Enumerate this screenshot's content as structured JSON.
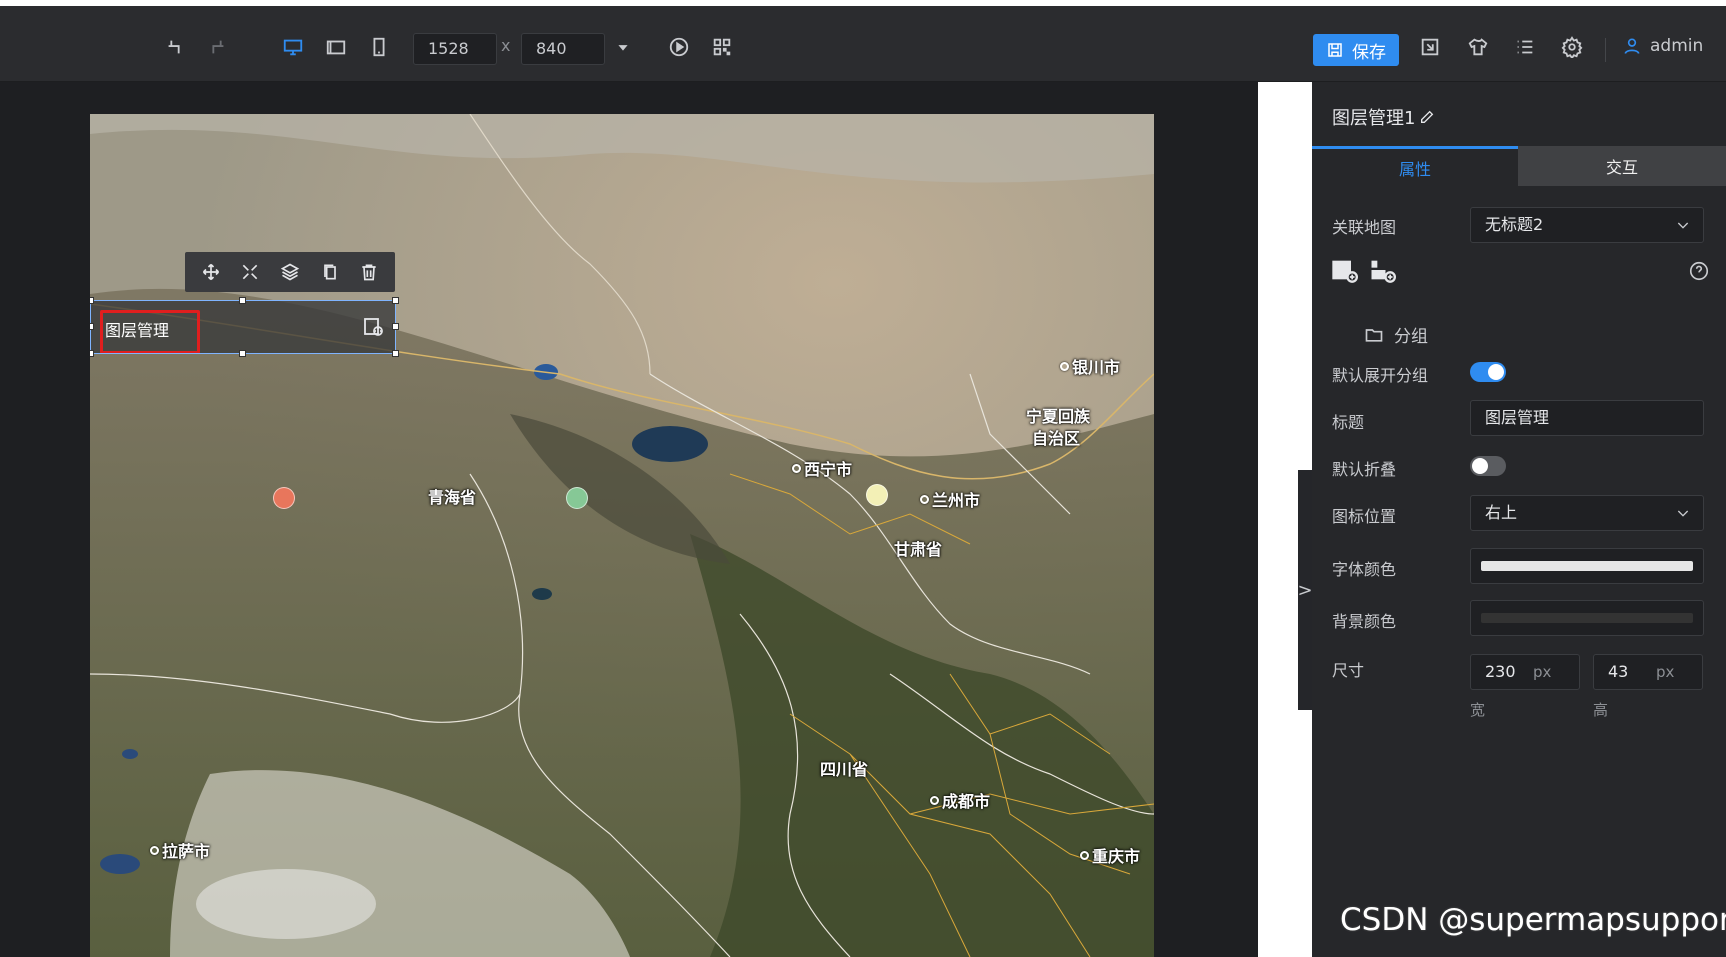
{
  "toolbar": {
    "icons": [
      "undo-icon",
      "redo-icon",
      "desktop-icon",
      "tablet-icon",
      "mobile-icon",
      "play-icon",
      "qrcode-icon"
    ],
    "width": "1528",
    "times": "x",
    "height": "840",
    "save_label": "保存",
    "right_icons": [
      "export-icon",
      "theme-icon",
      "list-icon",
      "settings-icon"
    ],
    "user": "admin",
    "accent": "#2f8cf0"
  },
  "map": {
    "cities": [
      {
        "name": "银川市"
      },
      {
        "name": "宁夏回族"
      },
      {
        "name": "自治区"
      },
      {
        "name": "西宁市"
      },
      {
        "name": "青海省"
      },
      {
        "name": "兰州市"
      },
      {
        "name": "甘肃省"
      },
      {
        "name": "四川省"
      },
      {
        "name": "成都市"
      },
      {
        "name": "拉萨市"
      },
      {
        "name": "重庆市"
      }
    ],
    "markers": [
      {
        "color": "#e8765c"
      },
      {
        "color": "#86c896"
      },
      {
        "color": "#f3f0b6"
      }
    ]
  },
  "widget": {
    "title": "图层管理",
    "tools": [
      "move-icon",
      "fullscreen-icon",
      "layers-icon",
      "copy-icon",
      "delete-icon"
    ]
  },
  "panel": {
    "title": "图层管理1",
    "tab_attr": "属性",
    "tab_interact": "交互",
    "linked_map_label": "关联地图",
    "linked_map_value": "无标题2",
    "group_label": "分组",
    "default_expand_label": "默认展开分组",
    "default_expand_on": true,
    "title_label": "标题",
    "title_value": "图层管理",
    "default_collapse_label": "默认折叠",
    "default_collapse_on": false,
    "icon_pos_label": "图标位置",
    "icon_pos_value": "右上",
    "font_color_label": "字体颜色",
    "font_color": "#e6e6e6",
    "bg_color_label": "背景颜色",
    "bg_color": "#333333",
    "size_label": "尺寸",
    "size_w": "230",
    "size_h": "43",
    "unit": "px",
    "w_label": "宽",
    "h_label": "高",
    "collapse_arrow": ">"
  },
  "watermark": "CSDN @supermapsupport"
}
